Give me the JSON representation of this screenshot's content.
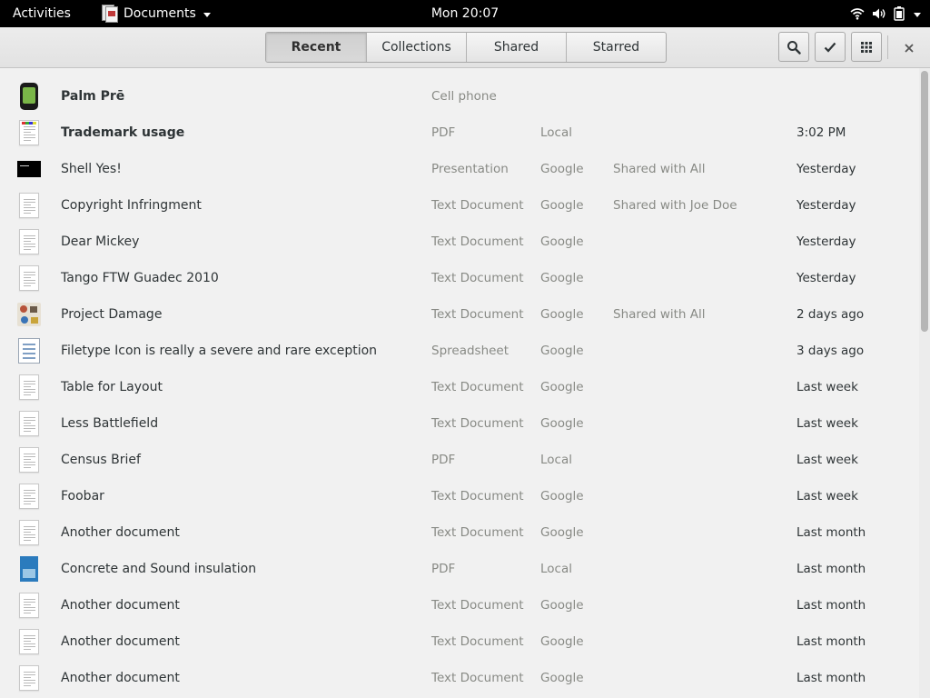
{
  "topbar": {
    "activities": "Activities",
    "app_name": "Documents",
    "clock": "Mon 20:07"
  },
  "header": {
    "tabs": [
      "Recent",
      "Collections",
      "Shared",
      "Starred"
    ],
    "active_tab": "Recent"
  },
  "icons": {
    "search": "search-icon",
    "select": "checkmark-icon",
    "view": "grid-icon",
    "close": "close-icon"
  },
  "rows": [
    {
      "name": "Palm Prē",
      "type": "Cell phone",
      "source": "",
      "shared": "",
      "date": "",
      "thumb": "phone",
      "bold": true
    },
    {
      "name": "Trademark usage",
      "type": "PDF",
      "source": "Local",
      "shared": "",
      "date": "3:02 PM",
      "thumb": "pdf",
      "bold": true
    },
    {
      "name": "Shell Yes!",
      "type": "Presentation",
      "source": "Google",
      "shared": "Shared with All",
      "date": "Yesterday",
      "thumb": "pres",
      "bold": false
    },
    {
      "name": "Copyright Infringment",
      "type": "Text Document",
      "source": "Google",
      "shared": "Shared with Joe Doe",
      "date": "Yesterday",
      "thumb": "doc",
      "bold": false
    },
    {
      "name": "Dear Mickey",
      "type": "Text Document",
      "source": "Google",
      "shared": "",
      "date": "Yesterday",
      "thumb": "doc",
      "bold": false
    },
    {
      "name": "Tango FTW Guadec 2010",
      "type": "Text Document",
      "source": "Google",
      "shared": "",
      "date": "Yesterday",
      "thumb": "doc",
      "bold": false
    },
    {
      "name": "Project Damage",
      "type": "Text Document",
      "source": "Google",
      "shared": "Shared with All",
      "date": "2 days ago",
      "thumb": "img",
      "bold": false
    },
    {
      "name": "Filetype Icon is really a severe and rare exception",
      "type": "Spreadsheet",
      "source": "Google",
      "shared": "",
      "date": "3 days ago",
      "thumb": "sheet",
      "bold": false
    },
    {
      "name": "Table for Layout",
      "type": "Text Document",
      "source": "Google",
      "shared": "",
      "date": "Last week",
      "thumb": "doc",
      "bold": false
    },
    {
      "name": "Less Battlefield",
      "type": "Text Document",
      "source": "Google",
      "shared": "",
      "date": "Last week",
      "thumb": "doc",
      "bold": false
    },
    {
      "name": "Census Brief",
      "type": "PDF",
      "source": "Local",
      "shared": "",
      "date": "Last week",
      "thumb": "doc",
      "bold": false
    },
    {
      "name": "Foobar",
      "type": "Text Document",
      "source": "Google",
      "shared": "",
      "date": "Last week",
      "thumb": "doc",
      "bold": false
    },
    {
      "name": "Another document",
      "type": "Text Document",
      "source": "Google",
      "shared": "",
      "date": "Last month",
      "thumb": "doc",
      "bold": false
    },
    {
      "name": "Concrete and Sound insulation",
      "type": "PDF",
      "source": "Local",
      "shared": "",
      "date": "Last month",
      "thumb": "blue",
      "bold": false
    },
    {
      "name": "Another document",
      "type": "Text Document",
      "source": "Google",
      "shared": "",
      "date": "Last month",
      "thumb": "doc",
      "bold": false
    },
    {
      "name": "Another document",
      "type": "Text Document",
      "source": "Google",
      "shared": "",
      "date": "Last month",
      "thumb": "doc",
      "bold": false
    },
    {
      "name": "Another document",
      "type": "Text Document",
      "source": "Google",
      "shared": "",
      "date": "Last month",
      "thumb": "doc",
      "bold": false
    }
  ]
}
